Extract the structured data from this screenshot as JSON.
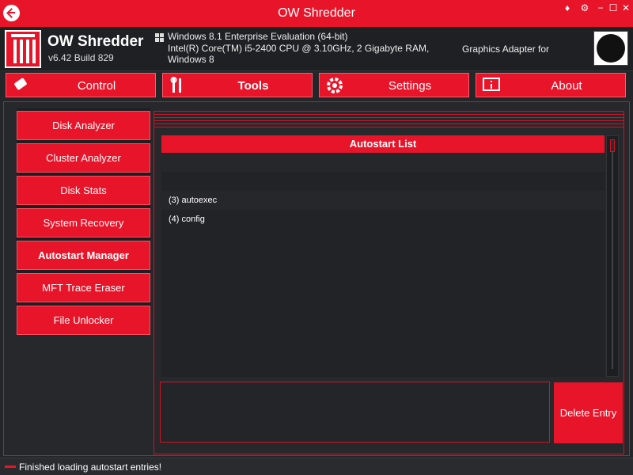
{
  "window": {
    "title": "OW Shredder"
  },
  "titlebar_controls": {
    "shield": "♦",
    "settings": "⚙",
    "minimize": "−",
    "maximize": "☐",
    "close": "✕"
  },
  "header": {
    "app_name": "OW Shredder",
    "version": "v6.42 Build 829",
    "os_line": "Windows 8.1 Enterprise Evaluation (64-bit)",
    "cpu_line": "Intel(R) Core(TM) i5-2400 CPU @ 3.10GHz, 2 Gigabyte RAM,",
    "os_short": "Windows 8",
    "graphics": "Graphics Adapter for"
  },
  "nav": {
    "tabs": [
      {
        "label": "Control",
        "icon": "eraser-icon"
      },
      {
        "label": "Tools",
        "icon": "tools-icon",
        "active": true
      },
      {
        "label": "Settings",
        "icon": "gear-icon"
      },
      {
        "label": "About",
        "icon": "info-icon"
      }
    ]
  },
  "sidebar": {
    "items": [
      {
        "label": "Disk Analyzer"
      },
      {
        "label": "Cluster Analyzer"
      },
      {
        "label": "Disk Stats"
      },
      {
        "label": "System Recovery"
      },
      {
        "label": "Autostart Manager",
        "active": true
      },
      {
        "label": "MFT Trace Eraser"
      },
      {
        "label": "File Unlocker"
      }
    ]
  },
  "autostart": {
    "header": "Autostart List",
    "rows": [
      {
        "text": ""
      },
      {
        "text": ""
      },
      {
        "text": "(3) autoexec"
      },
      {
        "text": "(4) config"
      }
    ],
    "delete_label": "Delete Entry"
  },
  "status": {
    "text": "Finished loading autostart entries!"
  },
  "colors": {
    "accent": "#e8152a",
    "background": "#25262a",
    "panel": "#1d1e21"
  }
}
